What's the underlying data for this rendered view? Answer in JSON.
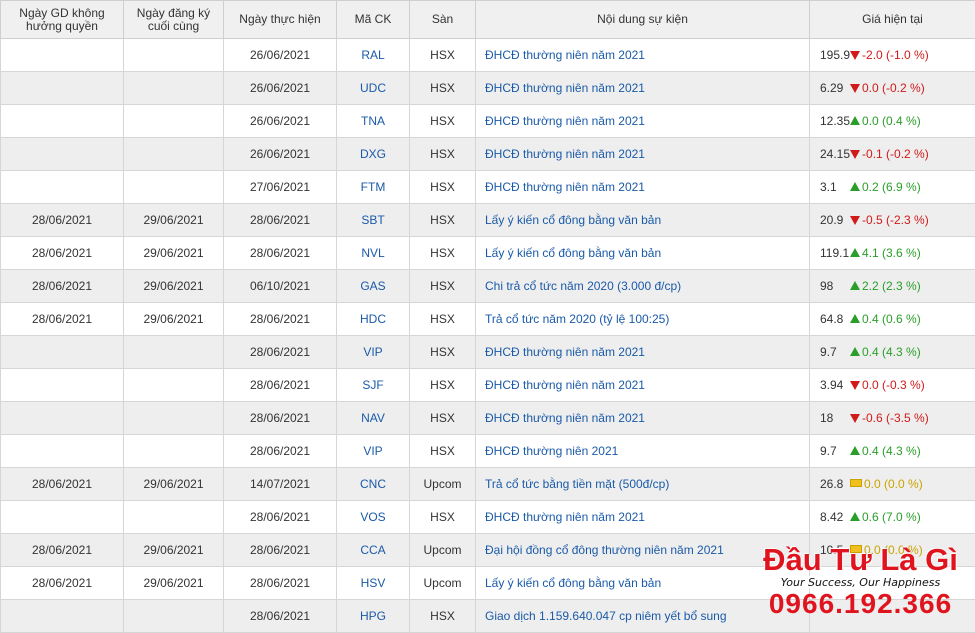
{
  "headers": [
    "Ngày GD không hưởng quyền",
    "Ngày đăng ký cuối cùng",
    "Ngày thực hiện",
    "Mã CK",
    "Sàn",
    "Nội dung sự kiện",
    "Giá hiện tại"
  ],
  "rows": [
    {
      "ex_date": "",
      "record_date": "",
      "exec_date": "26/06/2021",
      "code": "RAL",
      "exchange": "HSX",
      "event": "ĐHCĐ thường niên năm 2021",
      "price": "195.9",
      "dir": "down",
      "change": "-2.0 (-1.0 %)"
    },
    {
      "ex_date": "",
      "record_date": "",
      "exec_date": "26/06/2021",
      "code": "UDC",
      "exchange": "HSX",
      "event": "ĐHCĐ thường niên năm 2021",
      "price": "6.29",
      "dir": "down",
      "change": "0.0 (-0.2 %)"
    },
    {
      "ex_date": "",
      "record_date": "",
      "exec_date": "26/06/2021",
      "code": "TNA",
      "exchange": "HSX",
      "event": "ĐHCĐ thường niên năm 2021",
      "price": "12.35",
      "dir": "up",
      "change": "0.0 (0.4 %)"
    },
    {
      "ex_date": "",
      "record_date": "",
      "exec_date": "26/06/2021",
      "code": "DXG",
      "exchange": "HSX",
      "event": "ĐHCĐ thường niên năm 2021",
      "price": "24.15",
      "dir": "down",
      "change": "-0.1 (-0.2 %)"
    },
    {
      "ex_date": "",
      "record_date": "",
      "exec_date": "27/06/2021",
      "code": "FTM",
      "exchange": "HSX",
      "event": "ĐHCĐ thường niên năm 2021",
      "price": "3.1",
      "dir": "up",
      "change": "0.2 (6.9 %)"
    },
    {
      "ex_date": "28/06/2021",
      "record_date": "29/06/2021",
      "exec_date": "28/06/2021",
      "code": "SBT",
      "exchange": "HSX",
      "event": "Lấy ý kiến cổ đông bằng văn bản",
      "price": "20.9",
      "dir": "down",
      "change": "-0.5 (-2.3 %)"
    },
    {
      "ex_date": "28/06/2021",
      "record_date": "29/06/2021",
      "exec_date": "28/06/2021",
      "code": "NVL",
      "exchange": "HSX",
      "event": "Lấy ý kiến cổ đông bằng văn bản",
      "price": "119.1",
      "dir": "up",
      "change": "4.1 (3.6 %)"
    },
    {
      "ex_date": "28/06/2021",
      "record_date": "29/06/2021",
      "exec_date": "06/10/2021",
      "code": "GAS",
      "exchange": "HSX",
      "event": "Chi trả cổ tức năm 2020 (3.000 đ/cp)",
      "price": "98",
      "dir": "up",
      "change": "2.2 (2.3 %)"
    },
    {
      "ex_date": "28/06/2021",
      "record_date": "29/06/2021",
      "exec_date": "28/06/2021",
      "code": "HDC",
      "exchange": "HSX",
      "event": "Trả cổ tức năm 2020 (tỷ lệ 100:25)",
      "price": "64.8",
      "dir": "up",
      "change": "0.4 (0.6 %)"
    },
    {
      "ex_date": "",
      "record_date": "",
      "exec_date": "28/06/2021",
      "code": "VIP",
      "exchange": "HSX",
      "event": "ĐHCĐ thường niên năm 2021",
      "price": "9.7",
      "dir": "up",
      "change": "0.4 (4.3 %)"
    },
    {
      "ex_date": "",
      "record_date": "",
      "exec_date": "28/06/2021",
      "code": "SJF",
      "exchange": "HSX",
      "event": "ĐHCĐ thường niên năm 2021",
      "price": "3.94",
      "dir": "down",
      "change": "0.0 (-0.3 %)"
    },
    {
      "ex_date": "",
      "record_date": "",
      "exec_date": "28/06/2021",
      "code": "NAV",
      "exchange": "HSX",
      "event": "ĐHCĐ thường niên năm 2021",
      "price": "18",
      "dir": "down",
      "change": "-0.6 (-3.5 %)"
    },
    {
      "ex_date": "",
      "record_date": "",
      "exec_date": "28/06/2021",
      "code": "VIP",
      "exchange": "HSX",
      "event": "ĐHCĐ thường niên 2021",
      "price": "9.7",
      "dir": "up",
      "change": "0.4 (4.3 %)"
    },
    {
      "ex_date": "28/06/2021",
      "record_date": "29/06/2021",
      "exec_date": "14/07/2021",
      "code": "CNC",
      "exchange": "Upcom",
      "event": "Trả cổ tức bằng tiền mặt (500đ/cp)",
      "price": "26.8",
      "dir": "flat",
      "change": "0.0 (0.0 %)"
    },
    {
      "ex_date": "",
      "record_date": "",
      "exec_date": "28/06/2021",
      "code": "VOS",
      "exchange": "HSX",
      "event": "ĐHCĐ thường niên năm 2021",
      "price": "8.42",
      "dir": "up",
      "change": "0.6 (7.0 %)"
    },
    {
      "ex_date": "28/06/2021",
      "record_date": "29/06/2021",
      "exec_date": "28/06/2021",
      "code": "CCA",
      "exchange": "Upcom",
      "event": "Đại hội đồng cổ đông thường niên năm 2021",
      "price": "10.5",
      "dir": "flat",
      "change": "0.0 (0.0 %)"
    },
    {
      "ex_date": "28/06/2021",
      "record_date": "29/06/2021",
      "exec_date": "28/06/2021",
      "code": "HSV",
      "exchange": "Upcom",
      "event": "Lấy ý kiến cổ đông bằng văn bản",
      "price": "",
      "dir": "",
      "change": ""
    },
    {
      "ex_date": "",
      "record_date": "",
      "exec_date": "28/06/2021",
      "code": "HPG",
      "exchange": "HSX",
      "event": "Giao dịch 1.159.640.047 cp niêm yết bổ sung",
      "price": "",
      "dir": "",
      "change": ""
    }
  ],
  "watermark": {
    "title": "Đầu Tư Là Gì",
    "slogan": "Your Success, Our Happiness",
    "phone": "0966.192.366"
  },
  "colors": {
    "up": "#2a9e2a",
    "down": "#d11a1a",
    "flat": "#c9a400",
    "link": "#1a5aa8",
    "brand": "#e0141e"
  }
}
